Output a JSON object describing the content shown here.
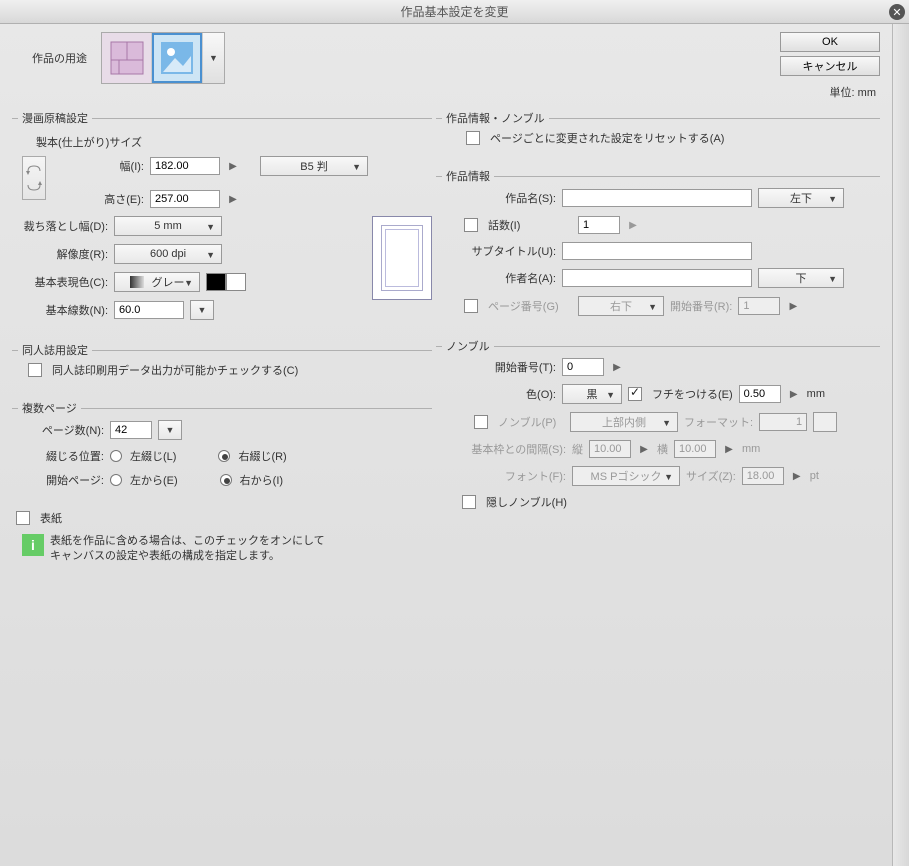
{
  "title": "作品基本設定を変更",
  "buttons": {
    "ok": "OK",
    "cancel": "キャンセル"
  },
  "unit_label": "単位:  mm",
  "purpose_label": "作品の用途",
  "manga": {
    "heading": "漫画原稿設定",
    "sizegroup": "製本(仕上がり)サイズ",
    "width_label": "幅(I):",
    "width": "182.00",
    "height_label": "高さ(E):",
    "height": "257.00",
    "preset": "B5 判",
    "bleed_label": "裁ち落とし幅(D):",
    "bleed": "5 mm",
    "res_label": "解像度(R):",
    "resolution": "600 dpi",
    "color_label": "基本表現色(C):",
    "color": "グレー",
    "lines_label": "基本線数(N):",
    "lines": "60.0"
  },
  "doujin": {
    "heading": "同人誌用設定",
    "check_label": "同人誌印刷用データ出力が可能かチェックする(C)"
  },
  "pages": {
    "heading": "複数ページ",
    "count_label": "ページ数(N):",
    "count": "42",
    "bind_label": "綴じる位置:",
    "left_bind": "左綴じ(L)",
    "right_bind": "右綴じ(R)",
    "start_label": "開始ページ:",
    "from_left": "左から(E)",
    "from_right": "右から(I)"
  },
  "cover": {
    "label": "表紙",
    "info": "表紙を作品に含める場合は、このチェックをオンにして\nキャンバスの設定や表紙の構成を指定します。"
  },
  "work": {
    "heading": "作品情報・ノンブル",
    "reset_label": "ページごとに変更された設定をリセットする(A)",
    "work_group": "作品情報",
    "name_label": "作品名(S):",
    "name_pos": "左下",
    "ep_label": "話数(I)",
    "ep_value": "1",
    "subtitle_label": "サブタイトル(U):",
    "author_label": "作者名(A):",
    "author_pos": "下",
    "pageno_label": "ページ番号(G)",
    "pageno_pos": "右下",
    "pageno_start_label": "開始番号(R):",
    "pageno_start": "1"
  },
  "nombre": {
    "heading": "ノンブル",
    "start_label": "開始番号(T):",
    "start": "0",
    "color_label": "色(O):",
    "color": "黒",
    "border_label": "フチをつける(E)",
    "border_val": "0.50",
    "border_unit": "mm",
    "nombre_check": "ノンブル(P)",
    "nombre_pos": "上部内側",
    "format_label": "フォーマット:",
    "format_val": "1",
    "gap_label": "基本枠との間隔(S):",
    "gap_v_label": "縦",
    "gap_v": "10.00",
    "gap_h_label": "横",
    "gap_h": "10.00",
    "gap_unit": "mm",
    "font_label": "フォント(F):",
    "font": "MS Pゴシック",
    "size_label": "サイズ(Z):",
    "size": "18.00",
    "size_unit": "pt",
    "hidden_label": "隠しノンブル(H)"
  }
}
